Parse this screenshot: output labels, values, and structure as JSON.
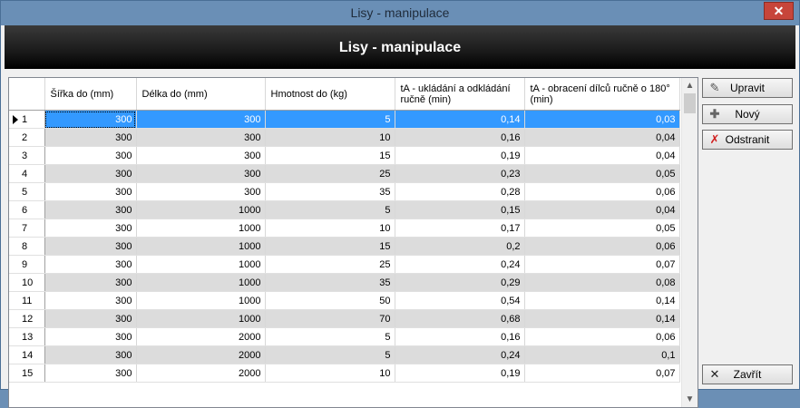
{
  "window": {
    "title": "Lisy - manipulace",
    "close_glyph": "✕"
  },
  "banner": {
    "title": "Lisy - manipulace"
  },
  "grid": {
    "columns": [
      "Šířka do (mm)",
      "Délka do (mm)",
      "Hmotnost do (kg)",
      "tA - ukládání a odkládání ručně (min)",
      "tA - obracení dílců ručně o 180° (min)"
    ],
    "rows": [
      {
        "n": "1",
        "c": [
          "300",
          "300",
          "5",
          "0,14",
          "0,03"
        ]
      },
      {
        "n": "2",
        "c": [
          "300",
          "300",
          "10",
          "0,16",
          "0,04"
        ]
      },
      {
        "n": "3",
        "c": [
          "300",
          "300",
          "15",
          "0,19",
          "0,04"
        ]
      },
      {
        "n": "4",
        "c": [
          "300",
          "300",
          "25",
          "0,23",
          "0,05"
        ]
      },
      {
        "n": "5",
        "c": [
          "300",
          "300",
          "35",
          "0,28",
          "0,06"
        ]
      },
      {
        "n": "6",
        "c": [
          "300",
          "1000",
          "5",
          "0,15",
          "0,04"
        ]
      },
      {
        "n": "7",
        "c": [
          "300",
          "1000",
          "10",
          "0,17",
          "0,05"
        ]
      },
      {
        "n": "8",
        "c": [
          "300",
          "1000",
          "15",
          "0,2",
          "0,06"
        ]
      },
      {
        "n": "9",
        "c": [
          "300",
          "1000",
          "25",
          "0,24",
          "0,07"
        ]
      },
      {
        "n": "10",
        "c": [
          "300",
          "1000",
          "35",
          "0,29",
          "0,08"
        ]
      },
      {
        "n": "11",
        "c": [
          "300",
          "1000",
          "50",
          "0,54",
          "0,14"
        ]
      },
      {
        "n": "12",
        "c": [
          "300",
          "1000",
          "70",
          "0,68",
          "0,14"
        ]
      },
      {
        "n": "13",
        "c": [
          "300",
          "2000",
          "5",
          "0,16",
          "0,06"
        ]
      },
      {
        "n": "14",
        "c": [
          "300",
          "2000",
          "5",
          "0,24",
          "0,1"
        ]
      },
      {
        "n": "15",
        "c": [
          "300",
          "2000",
          "10",
          "0,19",
          "0,07"
        ]
      }
    ],
    "selected_row": 0
  },
  "buttons": {
    "edit": {
      "label": "Upravit",
      "icon": "pencil-icon"
    },
    "new": {
      "label": "Nový",
      "icon": "plus-icon"
    },
    "delete": {
      "label": "Odstranit",
      "icon": "red-x-icon"
    },
    "close": {
      "label": "Zavřít",
      "icon": "close-x-icon"
    }
  },
  "colors": {
    "selection": "#3399ff",
    "alt_row": "#dcdcdc",
    "titlebar": "#6a8fb6",
    "delete_icon": "#d02020"
  }
}
